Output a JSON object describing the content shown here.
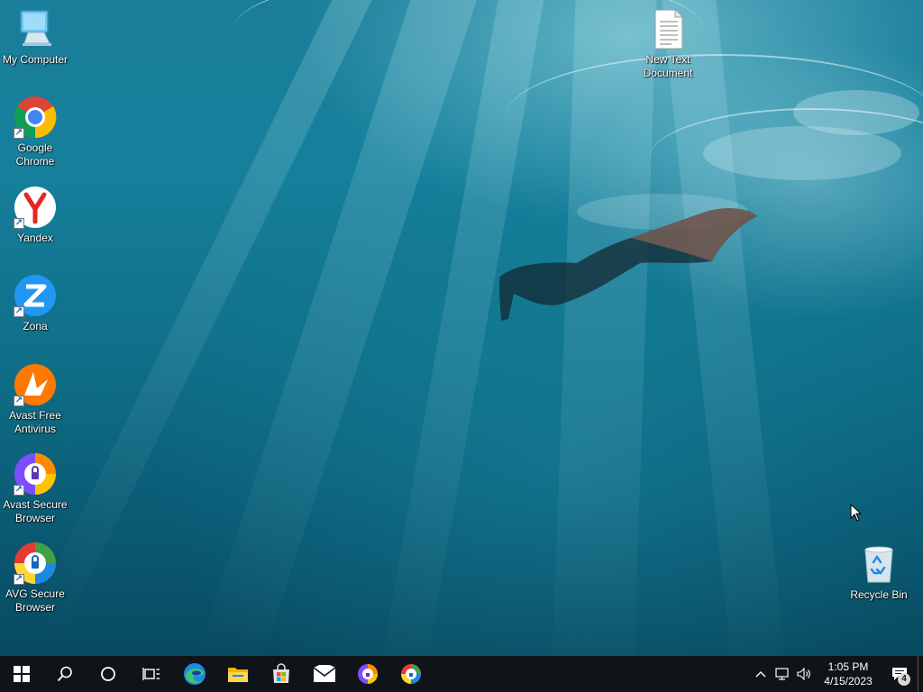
{
  "desktop_icons": {
    "my_computer": "My Computer",
    "chrome": "Google\nChrome",
    "yandex": "Yandex",
    "zona": "Zona",
    "avast_antivirus": "Avast Free\nAntivirus",
    "avast_browser": "Avast Secure\nBrowser",
    "avg_browser": "AVG Secure\nBrowser",
    "text_doc": "New Text\nDocument",
    "recycle_bin": "Recycle Bin"
  },
  "taskbar": {
    "apps": [
      "start-button",
      "search-button",
      "cortana-button",
      "task-view-button",
      "edge",
      "file-explorer",
      "microsoft-store",
      "mail",
      "avast-secure-browser",
      "avg-secure-browser"
    ]
  },
  "tray": {
    "time": "1:05 PM",
    "date": "4/15/2023",
    "notification_count": "4"
  },
  "colors": {
    "taskbar": "#101418",
    "accent_edge": "#1e88e5",
    "chrome_red": "#db4437"
  }
}
